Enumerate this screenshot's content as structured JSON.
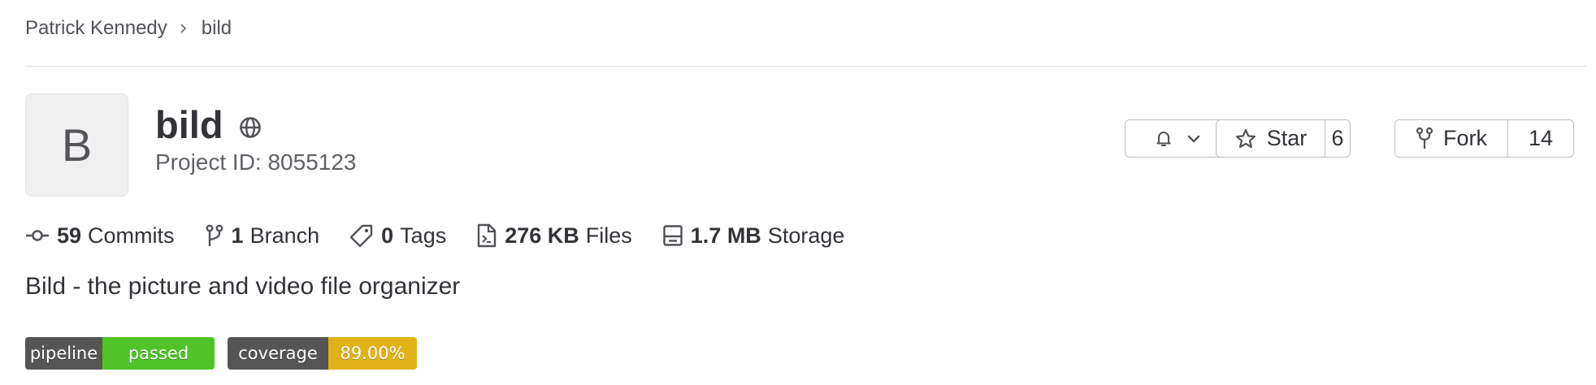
{
  "breadcrumb": {
    "owner": "Patrick Kennedy",
    "project": "bild"
  },
  "project": {
    "avatar_letter": "B",
    "name": "bild",
    "visibility_icon": "globe-icon",
    "id_label": "Project ID: 8055123",
    "description": "Bild - the picture and video file organizer"
  },
  "actions": {
    "notification_icon": "bell-icon",
    "star_label": "Star",
    "star_count": "6",
    "fork_label": "Fork",
    "fork_count": "14"
  },
  "stats": [
    {
      "icon": "commit-icon",
      "value": "59",
      "label": "Commits"
    },
    {
      "icon": "branch-icon",
      "value": "1",
      "label": "Branch"
    },
    {
      "icon": "tag-icon",
      "value": "0",
      "label": "Tags"
    },
    {
      "icon": "file-icon",
      "value": "276 KB",
      "label": "Files"
    },
    {
      "icon": "storage-icon",
      "value": "1.7 MB",
      "label": "Storage"
    }
  ],
  "badges": [
    {
      "label": "pipeline",
      "value": "passed",
      "color": "#4fc328"
    },
    {
      "label": "coverage",
      "value": "89.00%",
      "color": "#dfb317"
    }
  ]
}
